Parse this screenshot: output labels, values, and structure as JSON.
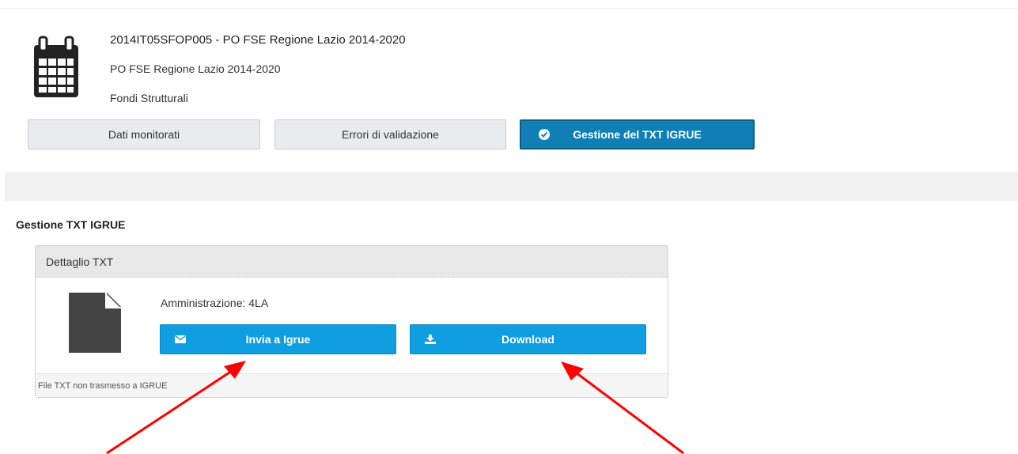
{
  "program": {
    "title": "2014IT05SFOP005 - PO FSE Regione Lazio 2014-2020",
    "subtitle": "PO FSE Regione Lazio 2014-2020",
    "type": "Fondi Strutturali",
    "icon": "calendar-icon"
  },
  "tabs": [
    {
      "label": "Dati monitorati",
      "active": false
    },
    {
      "label": "Errori di validazione",
      "active": false
    },
    {
      "label": "Gestione del TXT IGRUE",
      "active": true,
      "icon": "check-circle-icon"
    }
  ],
  "section": {
    "title": "Gestione TXT IGRUE"
  },
  "panel": {
    "header": "Dettaglio TXT",
    "file_icon": "file-icon",
    "amministrazione_label": "Amministrazione: ",
    "amministrazione_value": "4LA",
    "buttons": {
      "invia": {
        "label": "Invia a Igrue",
        "icon": "envelope-icon"
      },
      "download": {
        "label": "Download",
        "icon": "download-icon"
      }
    },
    "footer": "File TXT non trasmesso a IGRUE"
  },
  "colors": {
    "active_tab": "#0f7fb5",
    "button": "#0f9fe0",
    "annotation_arrow": "#ff0000"
  }
}
